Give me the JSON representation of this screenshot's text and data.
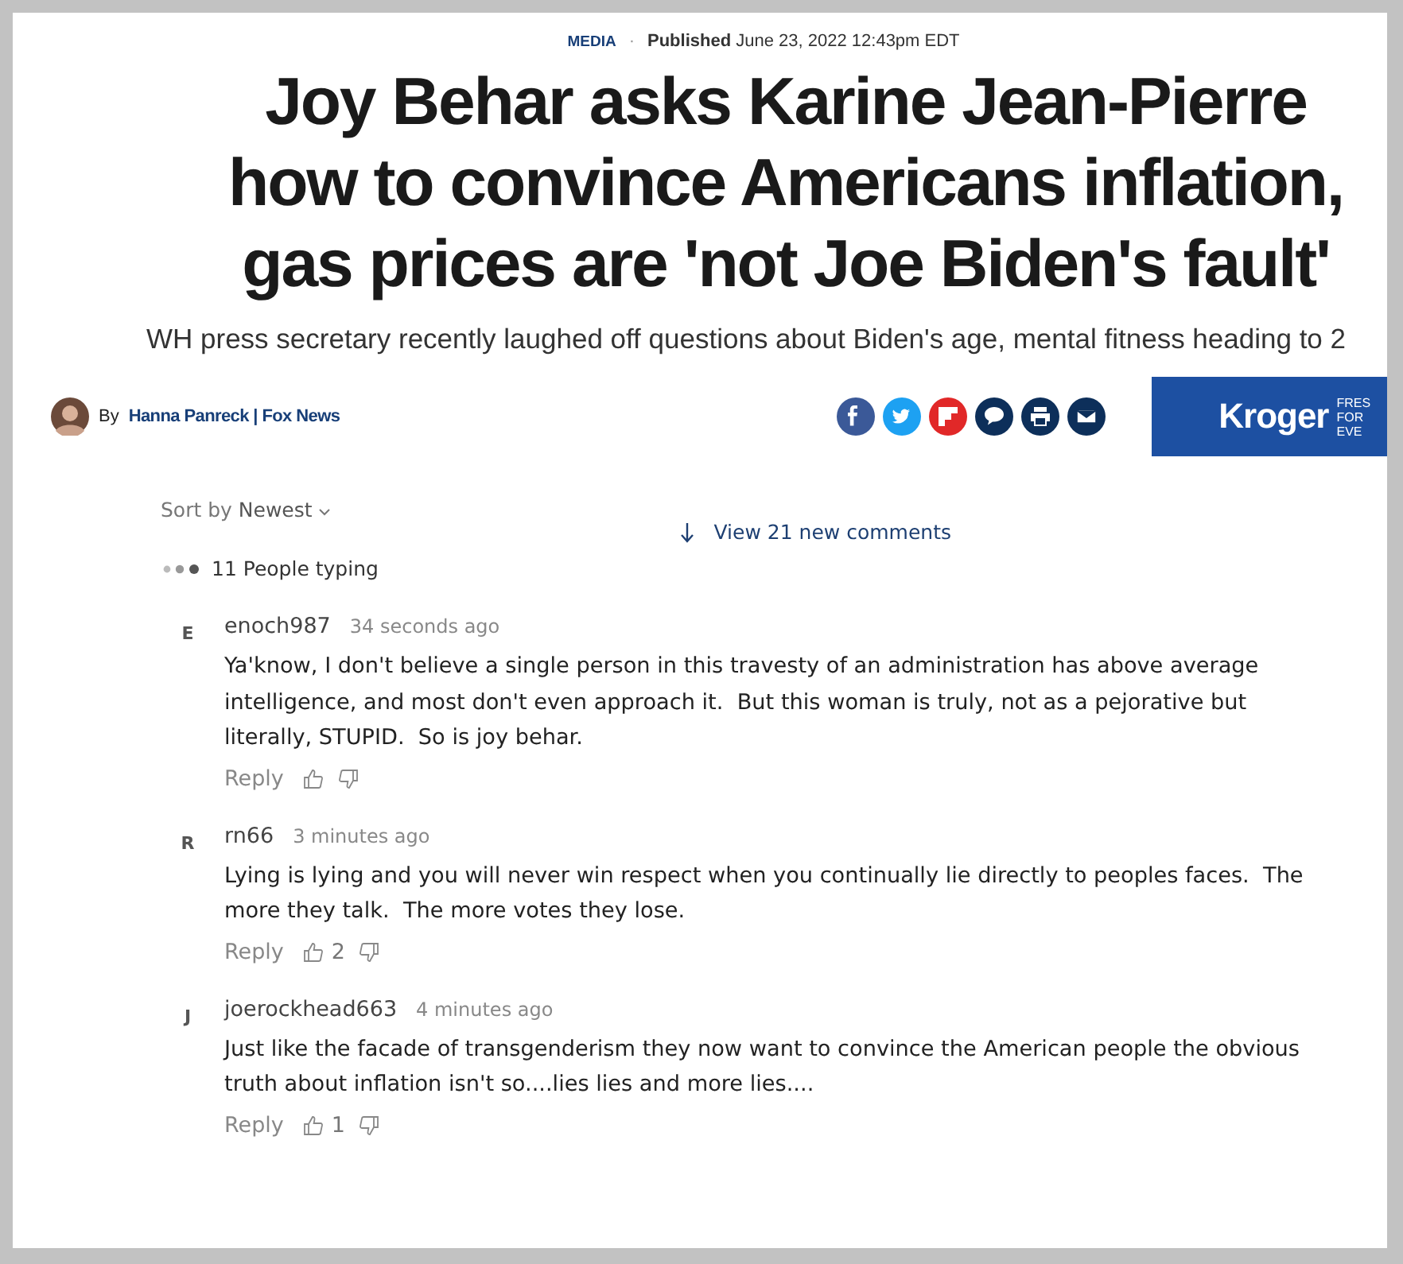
{
  "article": {
    "category": "MEDIA",
    "separator": "·",
    "published_label": "Published",
    "published_date": "June 23, 2022 12:43pm EDT",
    "headline": "Joy Behar asks Karine Jean-Pierre how to convince Americans inflation, gas prices are 'not Joe Biden's fault'",
    "subheadline": "WH press secretary recently laughed off questions about Biden's age, mental fitness heading to 2",
    "byline_prefix": "By",
    "author": "Hanna Panreck | Fox News",
    "share": [
      {
        "kind": "facebook"
      },
      {
        "kind": "twitter"
      },
      {
        "kind": "flipboard"
      },
      {
        "kind": "comments"
      },
      {
        "kind": "print"
      },
      {
        "kind": "email"
      }
    ]
  },
  "ad": {
    "brand": "Kroger",
    "tagline": [
      "FRES",
      "FOR",
      "EVE"
    ]
  },
  "comments_bar": {
    "sort_label": "Sort by",
    "sort_value": "Newest",
    "new_comments": "View 21 new comments",
    "typing": "11 People typing"
  },
  "comments": [
    {
      "initial": "E",
      "user": "enoch987",
      "time": "34 seconds ago",
      "text": "Ya'know, I don't believe a single person in this travesty of an administration has above average intelligence, and most don't even approach it.  But this woman is truly, not as a pejorative but literally, STUPID.  So is joy behar.",
      "reply": "Reply"
    },
    {
      "initial": "R",
      "user": "rn66",
      "time": "3 minutes ago",
      "text": "Lying is lying and you will never win respect when you continually lie directly to peoples faces.  The more they talk.  The more votes they lose.",
      "reply": "Reply",
      "likes": "2"
    },
    {
      "initial": "J",
      "user": "joerockhead663",
      "time": "4 minutes ago",
      "text": "Just like the facade of transgenderism they now want to convince the American people the obvious truth about inflation isn't so....lies lies and more lies....",
      "reply": "Reply",
      "likes": "1"
    }
  ]
}
